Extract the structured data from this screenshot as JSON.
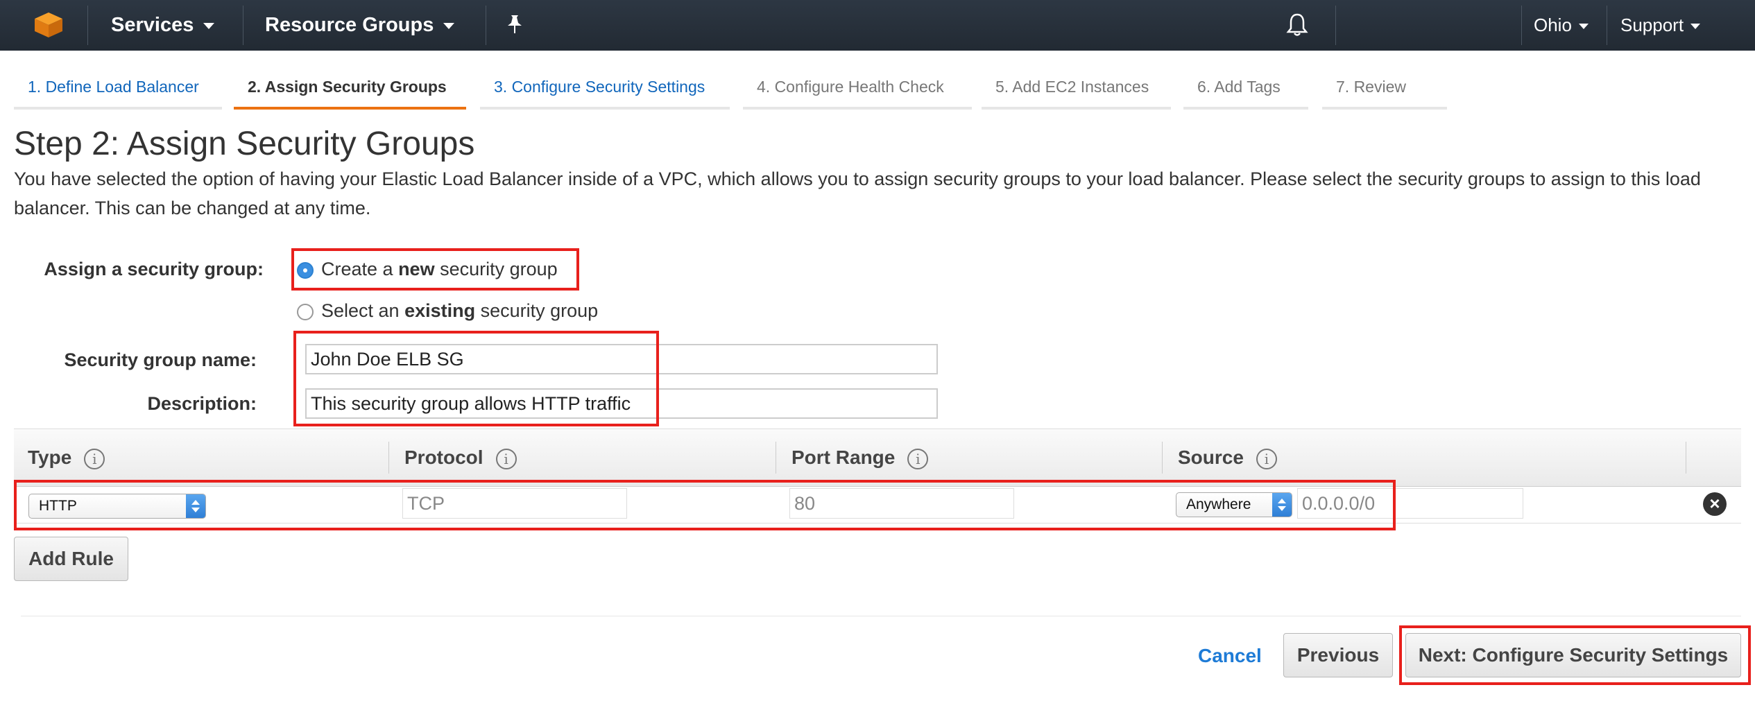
{
  "nav": {
    "services": "Services",
    "resource_groups": "Resource Groups",
    "region": "Ohio",
    "support": "Support"
  },
  "tabs": [
    {
      "label": "1. Define Load Balancer",
      "state": "link"
    },
    {
      "label": "2. Assign Security Groups",
      "state": "active"
    },
    {
      "label": "3. Configure Security Settings",
      "state": "link"
    },
    {
      "label": "4. Configure Health Check",
      "state": "disabled"
    },
    {
      "label": "5. Add EC2 Instances",
      "state": "disabled"
    },
    {
      "label": "6. Add Tags",
      "state": "disabled"
    },
    {
      "label": "7. Review",
      "state": "disabled"
    }
  ],
  "page": {
    "title": "Step 2: Assign Security Groups",
    "intro": "You have selected the option of having your Elastic Load Balancer inside of a VPC, which allows you to assign security groups to your load balancer. Please select the security groups to assign to this load balancer. This can be changed at any time."
  },
  "form": {
    "assign_label": "Assign a security group:",
    "option_new_pre": "Create a ",
    "option_new_bold": "new",
    "option_new_post": " security group",
    "option_new_selected": true,
    "option_existing_pre": "Select an ",
    "option_existing_bold": "existing",
    "option_existing_post": " security group",
    "name_label": "Security group name:",
    "name_value": "John Doe ELB SG",
    "desc_label": "Description:",
    "desc_value": "This security group allows HTTP traffic"
  },
  "rules_table": {
    "columns": [
      "Type",
      "Protocol",
      "Port Range",
      "Source"
    ],
    "rows": [
      {
        "type": "HTTP",
        "protocol": "TCP",
        "port_range": "80",
        "source_select": "Anywhere",
        "source_cidr": "0.0.0.0/0"
      }
    ],
    "add_rule": "Add Rule"
  },
  "footer": {
    "cancel": "Cancel",
    "previous": "Previous",
    "next": "Next: Configure Security Settings"
  },
  "colors": {
    "nav_bg": "#232f3e",
    "active_tab_underline": "#ec7211",
    "link": "#1166bb",
    "highlight_box": "#e8201c"
  }
}
